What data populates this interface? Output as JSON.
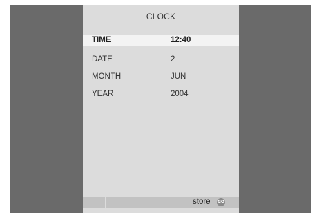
{
  "menu": {
    "title": "CLOCK",
    "rows": [
      {
        "label": "TIME",
        "value": "12:40"
      },
      {
        "label": "DATE",
        "value": "2"
      },
      {
        "label": "MONTH",
        "value": "JUN"
      },
      {
        "label": "YEAR",
        "value": "2004"
      }
    ],
    "selected_row": "TIME"
  },
  "footer": {
    "store_label": "store",
    "go_label": "GO",
    "go_icon": "go-button-icon"
  },
  "colors": {
    "background": "#6a6a6a",
    "panel": "#dcdcdc",
    "highlight": "#f3f3f3",
    "footer_bar": "#c2c2c2"
  }
}
